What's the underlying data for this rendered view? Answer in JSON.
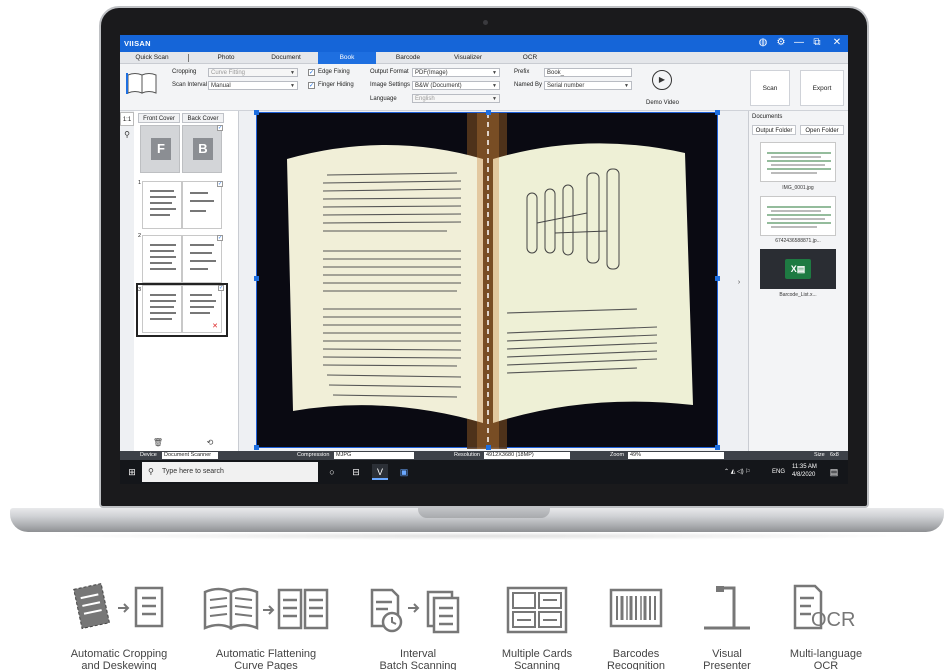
{
  "app": {
    "name": "VIISAN",
    "tabs": [
      "Quick Scan",
      "Photo",
      "Document",
      "Book",
      "Barcode",
      "Visualizer",
      "OCR"
    ],
    "active_tab": "Book"
  },
  "ribbon": {
    "cropping_label": "Cropping",
    "cropping_value": "Curve Fitting",
    "scan_interval_label": "Scan Interval",
    "scan_interval_value": "Manual",
    "edge_fixing_label": "Edge Fixing",
    "finger_hiding_label": "Finger Hiding",
    "output_format_label": "Output Format",
    "output_format_value": "PDF(Image)",
    "image_settings_label": "Image Settings",
    "image_settings_value": "B&W (Document)",
    "language_label": "Language",
    "language_value": "English",
    "prefix_label": "Prefix",
    "prefix_value": "Book_",
    "named_by_label": "Named By",
    "named_by_value": "Serial number",
    "demo_video_label": "Demo Video",
    "scan_label": "Scan",
    "export_label": "Export"
  },
  "left_panel": {
    "zoom_ratio": "1:1",
    "front_cover_label": "Front Cover",
    "back_cover_label": "Back Cover",
    "front_letter": "F",
    "back_letter": "B",
    "row_numbers": [
      "1",
      "2",
      "3"
    ]
  },
  "right_panel": {
    "heading": "Documents",
    "output_folder_label": "Output Folder",
    "open_folder_label": "Open Folder",
    "files": [
      "IMG_0001.jpg",
      "6742436588871.jp...",
      "Barcode_List.x..."
    ]
  },
  "status_bar": {
    "device_label": "Device",
    "device_value": "Document Scanner",
    "compression_label": "Compression",
    "compression_value": "MJPG",
    "resolution_label": "Resolution",
    "resolution_value": "4912X3680 (18MP)",
    "zoom_label": "Zoom",
    "zoom_value": "49%",
    "size_label": "Size",
    "size_value": "6x8"
  },
  "taskbar": {
    "search_placeholder": "Type here to search",
    "language": "ENG",
    "time": "11:35 AM",
    "date": "4/8/2020"
  },
  "features": [
    {
      "line1": "Automatic Cropping",
      "line2": "and Deskewing",
      "icon": "crop-deskew-icon"
    },
    {
      "line1": "Automatic Flattening",
      "line2": "Curve Pages",
      "icon": "flatten-pages-icon"
    },
    {
      "line1": "Interval",
      "line2": "Batch Scanning",
      "icon": "interval-scan-icon"
    },
    {
      "line1": "Multiple Cards",
      "line2": "Scanning",
      "icon": "multi-cards-icon"
    },
    {
      "line1": "Barcodes",
      "line2": "Recognition",
      "icon": "barcode-icon"
    },
    {
      "line1": "Visual",
      "line2": "Presenter",
      "icon": "visual-presenter-icon"
    },
    {
      "line1": "Multi-language",
      "line2": "OCR",
      "icon": "ocr-icon"
    }
  ],
  "ocr_icon_text": "OCR",
  "colors": {
    "accent": "#1e6fe0",
    "title_bar": "#1565d8",
    "taskbar": "#14161a"
  }
}
